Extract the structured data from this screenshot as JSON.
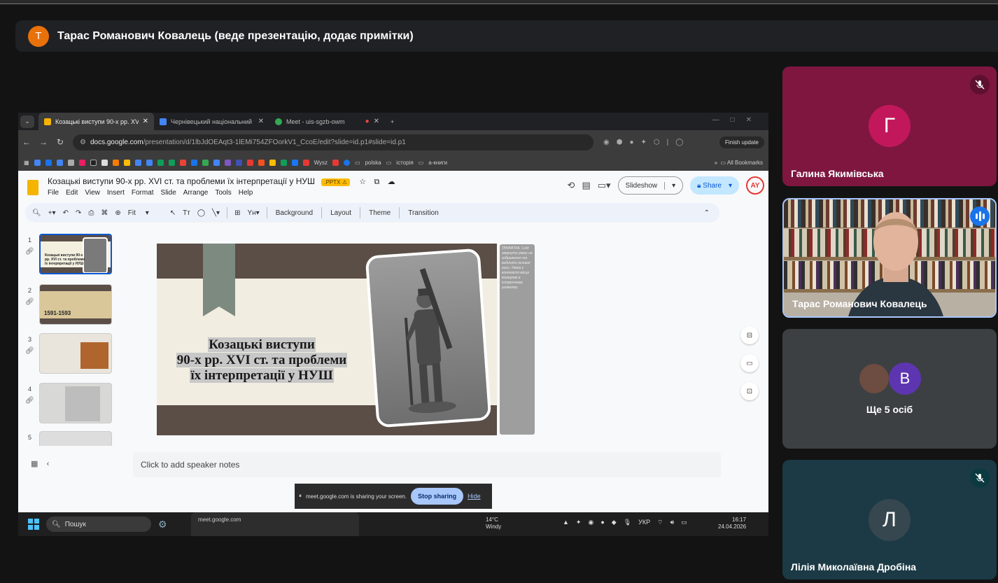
{
  "presenter": {
    "avatar_letter": "Т",
    "banner": "Тарас Романович Ковалець (веде презентацію, додає примітки)"
  },
  "browser": {
    "tabs": [
      {
        "label": "Козацькі виступи 90-х рр. XVI",
        "color": "#f4b400"
      },
      {
        "label": "Чернівецький національний у",
        "color": "#4285f4"
      },
      {
        "label": "Meet - uis-sgzb-owm",
        "color": "#34a853"
      }
    ],
    "url_host": "docs.google.com",
    "url_path": "/presentation/d/1lbJdOEAqt3-1lEMi754ZFOorkV1_CcoE/edit?slide=id.p1#slide=id.p1",
    "finish_update": "Finish update",
    "bookmarks": [
      "Wysz",
      "polska",
      "історія",
      "а-книги"
    ],
    "all_bookmarks": "All Bookmarks"
  },
  "slides_app": {
    "title": "Козацькі виступи 90-х рр. XVI ст. та проблеми їх інтерпретації у НУШ",
    "badge": ".PPTX",
    "menu": [
      "File",
      "Edit",
      "View",
      "Insert",
      "Format",
      "Slide",
      "Arrange",
      "Tools",
      "Help"
    ],
    "slideshow": "Slideshow",
    "share": "Share",
    "account": "AY",
    "zoom": "Fit",
    "toolbar_labels": [
      "Background",
      "Layout",
      "Theme",
      "Transition"
    ],
    "thumb_numbers": [
      "1",
      "2",
      "3",
      "4",
      "5"
    ],
    "thumb1_text": "Козацькі виступи 90-х рр. XVI ст. та проблеми їх інтерпретації у НУШ",
    "thumb2_text": "1591-1593",
    "slide_title": [
      "Козацькі виступи",
      "90-х рр. XVI ст. та проблеми",
      "їх інтерпретації у НУШ"
    ],
    "note_text": "ПРИМІТКА. Слід звернути увагу на зображення та виділити основні риси. Увага у контексті місця козацтва в історичному розвитку.",
    "speaker_notes": "Click to add speaker notes"
  },
  "screen_share": {
    "message": "meet.google.com is sharing your screen.",
    "stop": "Stop sharing",
    "hide": "Hide"
  },
  "taskbar": {
    "search": "Пошук",
    "popup": "meet.google.com",
    "temp": "14°C",
    "weather": "Windy",
    "lang": "УКР",
    "time": "16:17",
    "date": "24.04.2026"
  },
  "participants": [
    {
      "letter": "Г",
      "name": "Галина Якимівська",
      "color": "#c2185b"
    },
    {
      "name": "Тарас Романович Ковалець"
    },
    {
      "letter": "В",
      "name": "Ще 5 осіб",
      "color": "#5e35b1"
    },
    {
      "letter": "Л",
      "name": "Лілія Миколаївна Дробіна",
      "color": "#37474f"
    }
  ]
}
